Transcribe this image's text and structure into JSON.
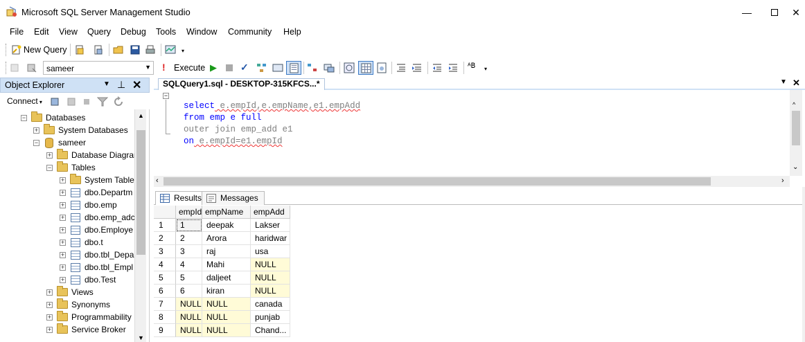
{
  "window": {
    "title": "Microsoft SQL Server Management Studio"
  },
  "menu": [
    "File",
    "Edit",
    "View",
    "Query",
    "Debug",
    "Tools",
    "Window",
    "Community",
    "Help"
  ],
  "toolbar1": {
    "new_query": "New Query"
  },
  "toolbar2": {
    "database": "sameer",
    "execute": "Execute"
  },
  "object_explorer": {
    "title": "Object Explorer",
    "connect": "Connect",
    "tree": [
      {
        "label": "Databases",
        "icon": "folder",
        "level": 0,
        "expander": "−"
      },
      {
        "label": "System Databases",
        "icon": "folder",
        "level": 1,
        "expander": "+"
      },
      {
        "label": "sameer",
        "icon": "database",
        "level": 1,
        "expander": "−"
      },
      {
        "label": "Database Diagrar",
        "icon": "folder",
        "level": 2,
        "expander": "+"
      },
      {
        "label": "Tables",
        "icon": "folder",
        "level": 2,
        "expander": "−"
      },
      {
        "label": "System Table",
        "icon": "folder",
        "level": 3,
        "expander": "+"
      },
      {
        "label": "dbo.Departm",
        "icon": "table",
        "level": 3,
        "expander": "+"
      },
      {
        "label": "dbo.emp",
        "icon": "table",
        "level": 3,
        "expander": "+"
      },
      {
        "label": "dbo.emp_adc",
        "icon": "table",
        "level": 3,
        "expander": "+"
      },
      {
        "label": "dbo.Employe",
        "icon": "table",
        "level": 3,
        "expander": "+"
      },
      {
        "label": "dbo.t",
        "icon": "table",
        "level": 3,
        "expander": "+"
      },
      {
        "label": "dbo.tbl_Depa",
        "icon": "table",
        "level": 3,
        "expander": "+"
      },
      {
        "label": "dbo.tbl_Empl",
        "icon": "table",
        "level": 3,
        "expander": "+"
      },
      {
        "label": "dbo.Test",
        "icon": "table",
        "level": 3,
        "expander": "+"
      },
      {
        "label": "Views",
        "icon": "folder",
        "level": 2,
        "expander": "+"
      },
      {
        "label": "Synonyms",
        "icon": "folder",
        "level": 2,
        "expander": "+"
      },
      {
        "label": "Programmability",
        "icon": "folder",
        "level": 2,
        "expander": "+"
      },
      {
        "label": "Service Broker",
        "icon": "folder",
        "level": 2,
        "expander": "+"
      }
    ]
  },
  "editor": {
    "tab_title": "SQLQuery1.sql - DESKTOP-315KFCS...*",
    "lines": [
      [
        "select",
        " e.empId,e.empName,e1.empAdd"
      ],
      [
        "from",
        " emp e full"
      ],
      [
        "outer join",
        " emp_add e1"
      ],
      [
        "on",
        " e.empId=e1.empId"
      ]
    ]
  },
  "results": {
    "tabs": [
      "Results",
      "Messages"
    ],
    "columns": [
      "empId",
      "empName",
      "empAdd"
    ],
    "rows": [
      [
        "1",
        "deepak",
        "Lakser"
      ],
      [
        "2",
        "Arora",
        "haridwar"
      ],
      [
        "3",
        "raj",
        "usa"
      ],
      [
        "4",
        "Mahi",
        "NULL"
      ],
      [
        "5",
        "daljeet",
        "NULL"
      ],
      [
        "6",
        "kiran",
        "NULL"
      ],
      [
        "NULL",
        "NULL",
        "canada"
      ],
      [
        "NULL",
        "NULL",
        "punjab"
      ],
      [
        "NULL",
        "NULL",
        "Chand..."
      ]
    ]
  }
}
